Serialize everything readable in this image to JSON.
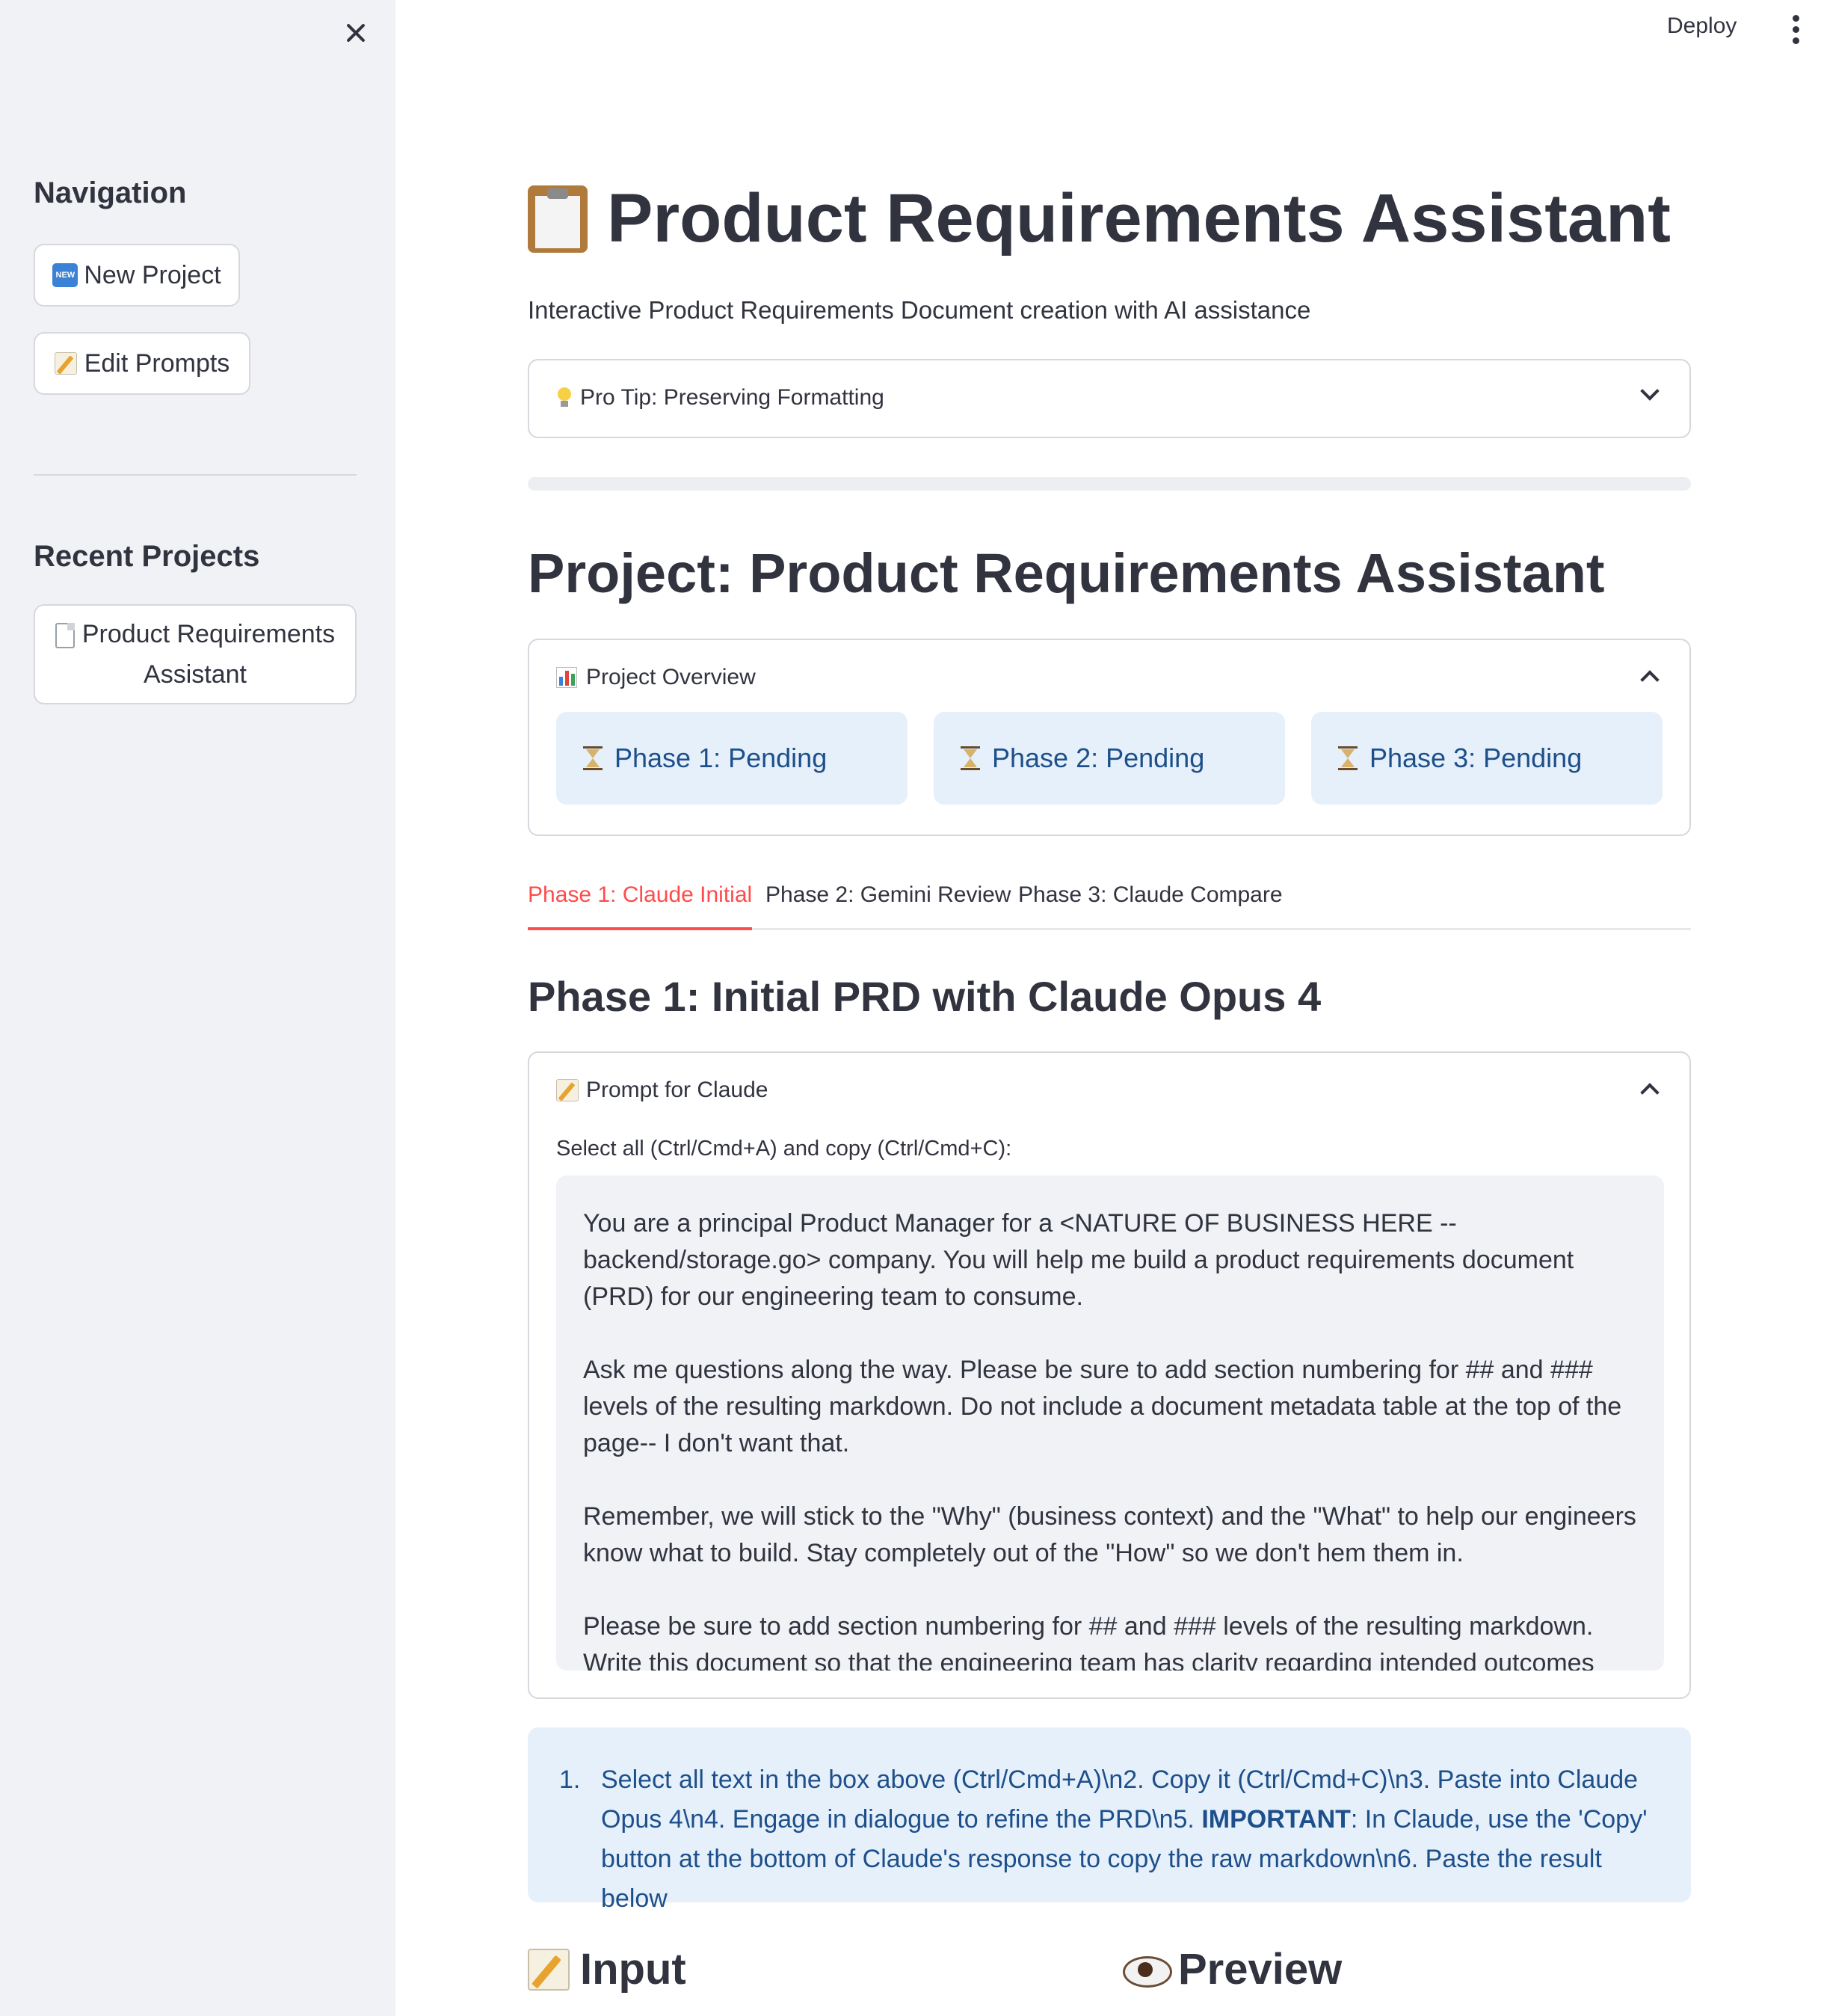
{
  "sidebar": {
    "navigation_heading": "Navigation",
    "new_project_label": "New Project",
    "new_project_icon_text": "NEW",
    "edit_prompts_label": "Edit Prompts",
    "recent_heading": "Recent Projects",
    "recent_projects": [
      {
        "line1": "Product Requirements",
        "line2": "Assistant"
      }
    ]
  },
  "header": {
    "deploy_label": "Deploy"
  },
  "main": {
    "title": "Product Requirements Assistant",
    "subtitle": "Interactive Product Requirements Document creation with AI assistance",
    "pro_tip_label": "Pro Tip: Preserving Formatting",
    "project_heading": "Project: Product Requirements Assistant",
    "overview": {
      "label": "Project Overview",
      "phases": [
        {
          "label": "Phase 1: Pending"
        },
        {
          "label": "Phase 2: Pending"
        },
        {
          "label": "Phase 3: Pending"
        }
      ]
    },
    "tabs": [
      {
        "label": "Phase 1: Claude Initial",
        "active": true
      },
      {
        "label": "Phase 2: Gemini Review",
        "active": false
      },
      {
        "label": "Phase 3: Claude Compare",
        "active": false
      }
    ],
    "phase_heading": "Phase 1: Initial PRD with Claude Opus 4",
    "prompt_expander": {
      "label": "Prompt for Claude",
      "instruction": "Select all (Ctrl/Cmd+A) and copy (Ctrl/Cmd+C):",
      "prompt_text": "You are a principal Product Manager for a <NATURE OF BUSINESS HERE -- backend/storage.go> company. You will help me build a product requirements document (PRD) for our engineering team to consume.\n\nAsk me questions along the way. Please be sure to add section numbering for ## and ### levels of the resulting markdown. Do not include a document metadata table at the top of the page-- I don't want that.\n\nRemember, we will stick to the \"Why\" (business context) and the \"What\" to help our engineers know what to build. Stay completely out of the \"How\" so we don't hem them in.\n\nPlease be sure to add section numbering for ## and ### levels of the resulting markdown. Write this document so that the engineering team has clarity regarding intended outcomes and"
    },
    "info_box": {
      "number": "1.",
      "text_before": "Select all text in the box above (Ctrl/Cmd+A)\\n2. Copy it (Ctrl/Cmd+C)\\n3. Paste into Claude Opus 4\\n4. Engage in dialogue to refine the PRD\\n5. ",
      "bold": "IMPORTANT",
      "text_after": ": In Claude, use the 'Copy' button at the bottom of Claude's response to copy the raw markdown\\n6. Paste the result below"
    },
    "input_heading": "Input",
    "preview_heading": "Preview"
  },
  "colors": {
    "accent": "#ff4b4b",
    "info_bg": "#e6f0fb",
    "info_text": "#1d4f8a",
    "sidebar_bg": "#f0f2f6"
  }
}
